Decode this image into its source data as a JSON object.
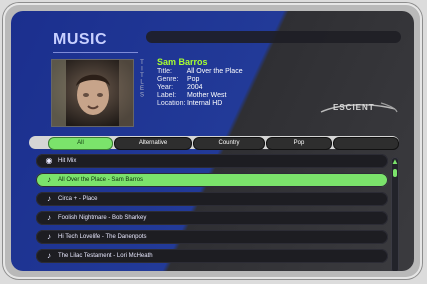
{
  "app": {
    "title": "MUSIC"
  },
  "now_playing": {
    "song": "Sam Barros",
    "fields": [
      {
        "label": "Title:",
        "value": "All Over the Place"
      },
      {
        "label": "Genre:",
        "value": "Pop"
      },
      {
        "label": "Year:",
        "value": "2004"
      },
      {
        "label": "Label:",
        "value": "Mother West"
      },
      {
        "label": "Location:",
        "value": "Internal HD"
      }
    ],
    "vertical_label": "TITLES"
  },
  "brand": {
    "logo_text": "ESCIENT"
  },
  "tabs": [
    {
      "label": "All",
      "active": true
    },
    {
      "label": "Alternative",
      "active": false
    },
    {
      "label": "Country",
      "active": false
    },
    {
      "label": "Pop",
      "active": false
    },
    {
      "label": "",
      "active": false
    }
  ],
  "list": {
    "items": [
      {
        "label": "Hit Mix",
        "icon": "cd-icon",
        "active": false
      },
      {
        "label": "All Over the Place - Sam Barros",
        "icon": "music-note-icon",
        "active": true
      },
      {
        "label": "Circa + - Place",
        "icon": "music-note-icon",
        "active": false
      },
      {
        "label": "Foolish Nightmare - Bob Sharkey",
        "icon": "music-note-icon",
        "active": false
      },
      {
        "label": "Hi Tech Lovelife - The Danenpots",
        "icon": "music-note-icon",
        "active": false
      },
      {
        "label": "The Lilac Testament - Lori McHeath",
        "icon": "music-note-icon",
        "active": false
      }
    ]
  },
  "colors": {
    "accent_green": "#7be36b",
    "panel_blue": "#223a98",
    "panel_dark": "#2f2f33"
  }
}
